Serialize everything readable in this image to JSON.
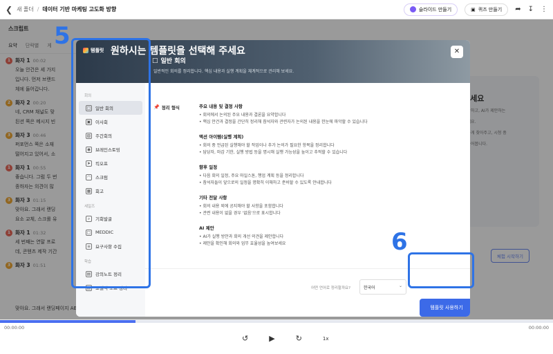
{
  "topbar": {
    "back_icon": "chevron-left-icon",
    "folder": "새 폴더",
    "separator": "/",
    "title": "데이터 기반 마케팅 고도화 방향",
    "slides_btn": "슬라이드 만들기",
    "quiz_btn": "퀴즈 만들기"
  },
  "left": {
    "header": "스크립트",
    "tabs": [
      "요약",
      "단락별",
      "게"
    ],
    "entries": [
      {
        "speaker": "화자 1",
        "time": "00:02",
        "color": "red",
        "initial": "1",
        "lines": [
          "오늘 안건은 세 가지",
          "입니다. 먼저 브랜드",
          "체에 들어갑니다."
        ]
      },
      {
        "speaker": "화자 2",
        "time": "00:20",
        "color": "orange",
        "initial": "2",
        "lines": [
          "네, CRM 채널도 맞",
          "된션 쪽은 메시지 빈"
        ]
      },
      {
        "speaker": "화자 3",
        "time": "00:46",
        "color": "orange",
        "initial": "3",
        "lines": [
          "퍼포먼스 쪽은 소재",
          "떨어지고 있어서, 소"
        ]
      },
      {
        "speaker": "화자 1",
        "time": "00:55",
        "color": "red",
        "initial": "1",
        "lines": [
          "좋습니다. 그럼 두 번",
          "종하자는 의견이 많"
        ]
      },
      {
        "speaker": "화자 3",
        "time": "01:15",
        "color": "orange",
        "initial": "3",
        "lines": [
          "맞아요. 그래서 랜딩",
          "요소 교체, 스크롤 유"
        ]
      },
      {
        "speaker": "화자 1",
        "time": "01:32",
        "color": "red",
        "initial": "1",
        "lines": [
          "세 번째는 연말 프로",
          "데, 콘텐츠 제작 기간"
        ]
      },
      {
        "speaker": "화자 3",
        "time": "01:51",
        "color": "orange",
        "initial": "3",
        "lines": []
      }
    ],
    "bottom_line": "맞아요. 그래서 랜딩페이지 AB 테스트를 우선으로 잡는 게 맞을 것 같아요. CTA 문구 변경, 첫 화면 시각"
  },
  "bg_card": {
    "title": "보세요",
    "lines": [
      "파악하고, AI가 제안하는",
      "보세요.",
      "",
      "화하게 찾아주고, 시청 중",
      "만들어봅니다."
    ],
    "start_btn": "체험 시작하기"
  },
  "player": {
    "progress": 0.245,
    "current": "00:00:00",
    "total": "00:00:00",
    "speed": "1x"
  },
  "modal": {
    "brand": "템플릿",
    "select_title": "원하시는 템플릿을 선택해 주세요",
    "template_name": "일반 회의",
    "template_desc": "일반적인 회의를 정리합니다. 핵심 내용과 실행 계획을 체계적으로 관리해 보세요.",
    "groups": [
      {
        "label": "회의",
        "items": [
          "일반 회의",
          "이사회",
          "주간회의",
          "브레인스토밍",
          "킥오프",
          "스크럼",
          "회고"
        ]
      },
      {
        "label": "세일즈",
        "items": [
          "기회발굴",
          "MEDDIC",
          "요구사항 수집"
        ]
      },
      {
        "label": "학습",
        "items": [
          "강의노트 정리",
          "코넬식 노트 정리"
        ]
      }
    ],
    "active_item": "일반 회의",
    "format_label": "정리 형식",
    "sections": [
      {
        "heading": "주요 내용 및 결정 사항",
        "bullets": [
          "• 회의에서 논의된 주요 내용과 결론을 요약합니다",
          "• 핵심 안건과 결정을 간단히 정리해 참석자와 관련자가 논의된 내용을 한눈에 파악할 수 있습니다"
        ]
      },
      {
        "heading": "액션 아이템(실행 계획)",
        "bullets": [
          "• 회의 중 언급된 실행해야 할 작업이나 추가 논의가 필요한 항목을 정리합니다",
          "• 담당자, 마감 기한, 실행 방법 등을 명시해 실행 가능성을 높이고 추적할 수 있습니다"
        ]
      },
      {
        "heading": "향후 일정",
        "bullets": [
          "• 다음 회의 일정, 주요 마일스톤, 행업 계획 등을 정리합니다",
          "• 참석자들이 앞으로의 일정을 명확히 이해하고 준비할 수 있도록 안내합니다"
        ]
      },
      {
        "heading": "기타 전달 사항",
        "bullets": [
          "• 회의 내용 외에 공지해야 할 사항을 포함합니다",
          "• 관련 내용이 없을 경우 '없음'으로 표시합니다"
        ]
      },
      {
        "heading": "AI 제안",
        "bullets": [
          "• AI가 실행 방안과 회의 개선 의견을 제안합니다",
          "• 제안을 확인해 회의와 업무 효율성을 높여보세요"
        ]
      }
    ],
    "lang_question": "어떤 언어로 정리할까요?",
    "lang_value": "한국어",
    "use_btn": "템플릿 사용하기"
  },
  "annotations": {
    "five": "5",
    "six": "6"
  },
  "colors": {
    "accent": "#3c6ae8",
    "annotation": "#2e73e6"
  }
}
